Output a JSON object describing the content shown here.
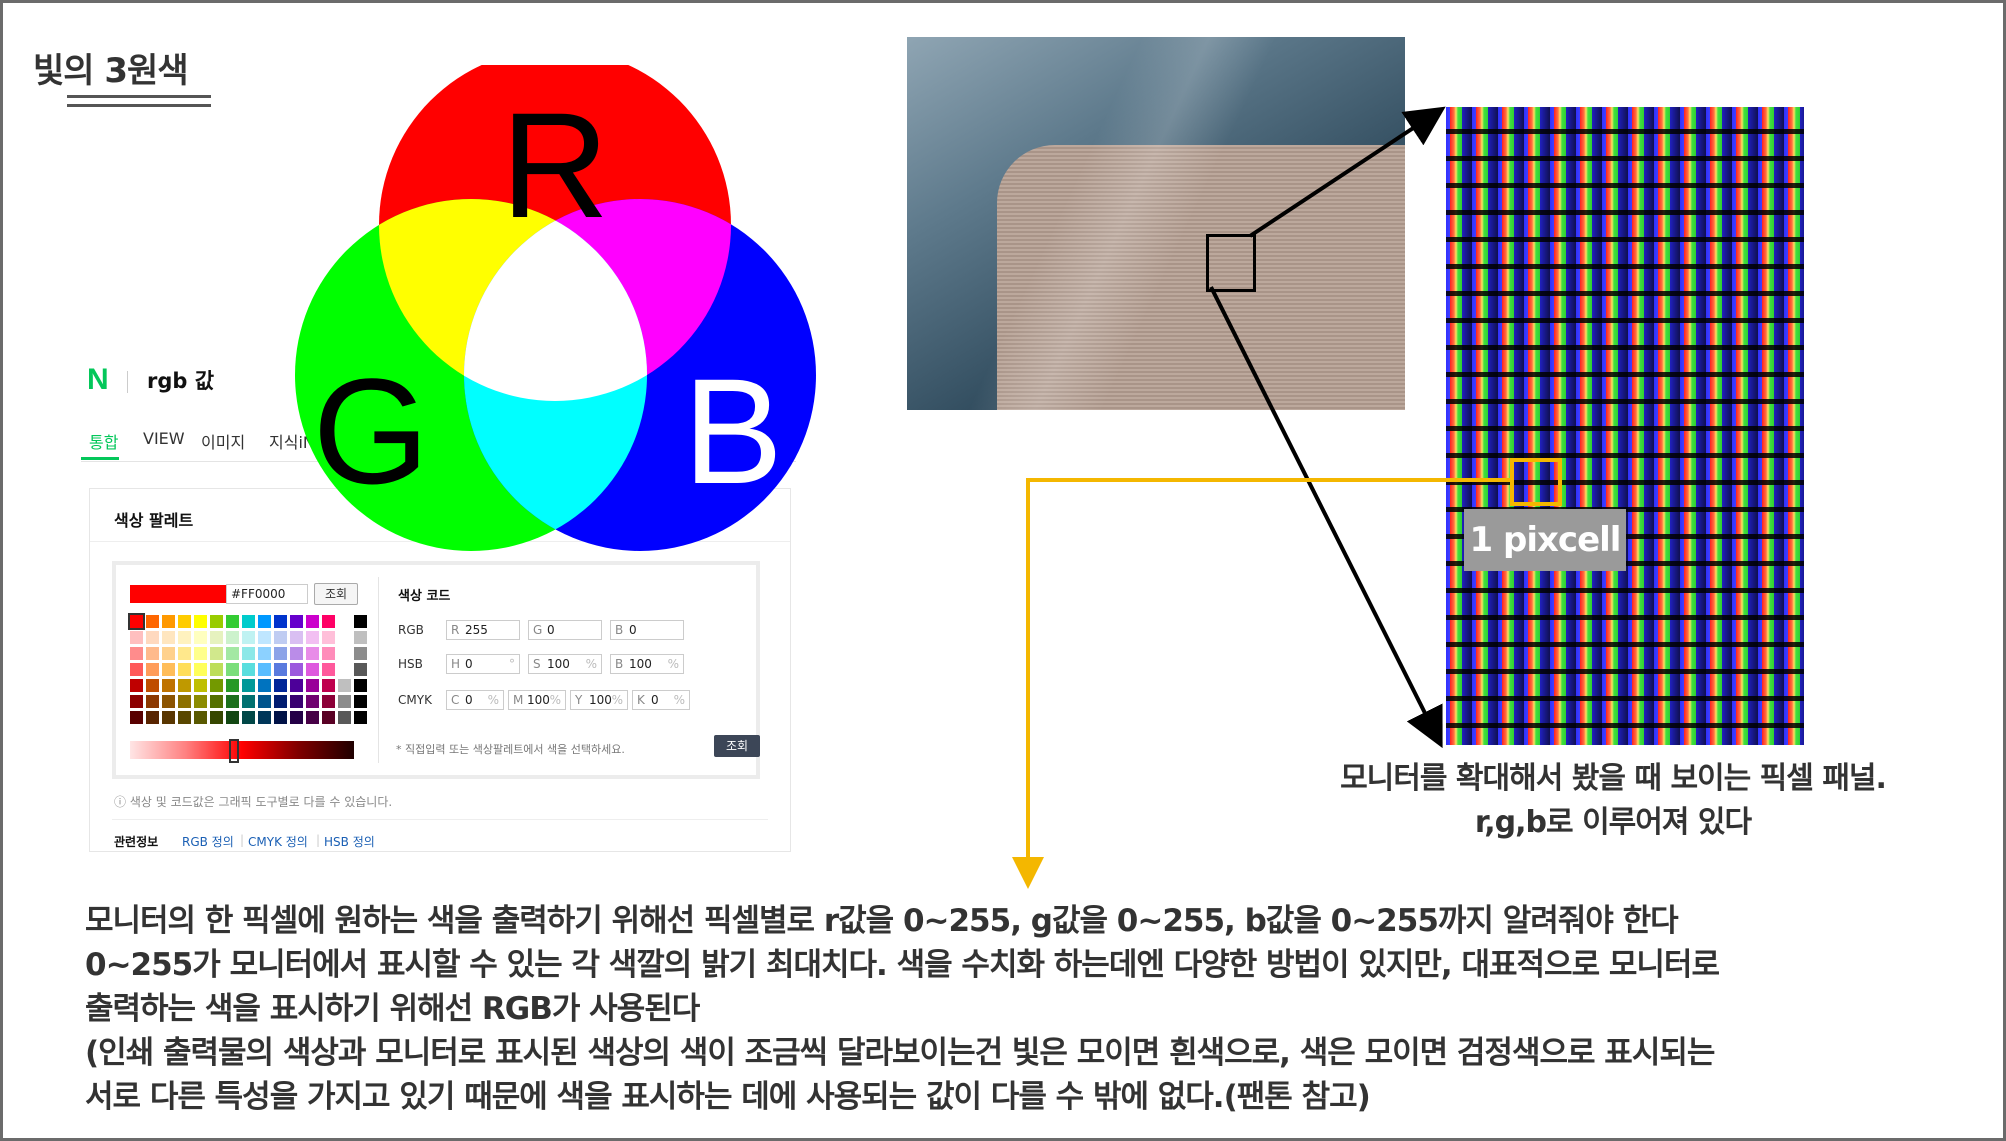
{
  "slide": {
    "title": "빛의 3원색"
  },
  "naver": {
    "logo": "N",
    "query": "rgb 값",
    "tabs": [
      "통합",
      "VIEW",
      "이미지",
      "지식iN"
    ],
    "card_title": "색상 팔레트",
    "hex_value": "#FF0000",
    "lookup_label": "조회",
    "code_title": "색상 코드",
    "rows": {
      "rgb": {
        "label": "RGB",
        "fields": [
          {
            "k": "R",
            "v": "255",
            "u": ""
          },
          {
            "k": "G",
            "v": "0",
            "u": ""
          },
          {
            "k": "B",
            "v": "0",
            "u": ""
          }
        ]
      },
      "hsb": {
        "label": "HSB",
        "fields": [
          {
            "k": "H",
            "v": "0",
            "u": "°"
          },
          {
            "k": "S",
            "v": "100",
            "u": "%"
          },
          {
            "k": "B",
            "v": "100",
            "u": "%"
          }
        ]
      },
      "cmyk": {
        "label": "CMYK",
        "fields": [
          {
            "k": "C",
            "v": "0",
            "u": "%"
          },
          {
            "k": "M",
            "v": "100",
            "u": "%"
          },
          {
            "k": "Y",
            "v": "100",
            "u": "%"
          },
          {
            "k": "K",
            "v": "0",
            "u": "%"
          }
        ]
      }
    },
    "note": "* 직접입력 또는 색상팔레트에서 색을 선택하세요.",
    "submit_label": "조회",
    "info": "ⓘ 색상 및 코드값은 그래픽 도구별로 다를 수 있습니다.",
    "related_label": "관련정보",
    "related_links": [
      "RGB 정의",
      "CMYK 정의",
      "HSB 정의"
    ],
    "palette_colors": [
      "#ff0000",
      "#ff6600",
      "#ff9900",
      "#ffcc00",
      "#ffff00",
      "#99cc00",
      "#33cc33",
      "#00cccc",
      "#0099ff",
      "#0033cc",
      "#6600cc",
      "#cc00cc",
      "#ff0066",
      "#ffffff",
      "#000000"
    ]
  },
  "venn": {
    "labels": {
      "r": "R",
      "g": "G",
      "b": "B"
    },
    "colors": {
      "red": "#ff0000",
      "green": "#00ff00",
      "blue": "#0000ff",
      "yellow": "#ffff00",
      "magenta": "#ff00ff",
      "cyan": "#00ffff",
      "white": "#ffffff"
    }
  },
  "pixel_label": "1 pixcell",
  "caption": {
    "line1": "모니터를 확대해서 봤을 때 보이는 픽셀 패널.",
    "line2": "r,g,b로 이루어져 있다"
  },
  "body": {
    "lines": [
      "모니터의 한 픽셀에 원하는 색을 출력하기 위해선 픽셀별로 r값을 0~255, g값을 0~255, b값을 0~255까지 알려줘야 한다",
      "0~255가 모니터에서 표시할 수 있는 각 색깔의 밝기 최대치다. 색을 수치화 하는데엔 다양한 방법이 있지만, 대표적으로 모니터로",
      "출력하는 색을 표시하기 위해선 RGB가 사용된다",
      "(인쇄 출력물의 색상과 모니터로 표시된 색상의 색이 조금씩 달라보이는건 빛은 모이면 흰색으로, 색은 모이면 검정색으로 표시되는",
      "서로 다른 특성을 가지고 있기 때문에 색을 표시하는 데에 사용되는 값이 다를 수 밖에 없다.(팬톤 참고)"
    ]
  },
  "accent": {
    "arrow_black": "#000000",
    "arrow_yellow": "#f4b700",
    "naver_green": "#03c75a"
  }
}
